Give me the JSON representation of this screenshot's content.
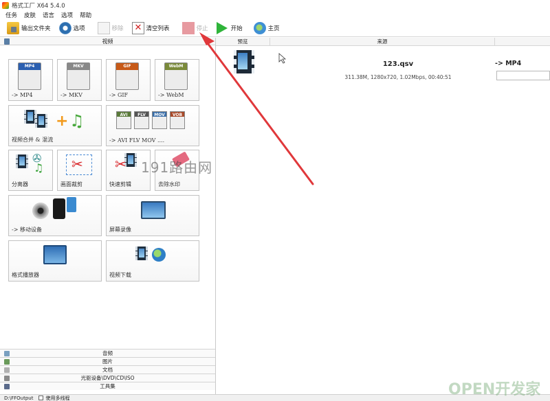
{
  "window": {
    "title": "格式工厂 X64 5.4.0"
  },
  "menu": [
    "任务",
    "皮肤",
    "语言",
    "选项",
    "帮助"
  ],
  "toolbar": {
    "output_folder": "输出文件夹",
    "options": "选项",
    "remove": "移除",
    "clear_list": "清空列表",
    "stop": "停止",
    "start": "开始",
    "home": "主页"
  },
  "left": {
    "section_video": "视频",
    "tiles": {
      "mp4": {
        "badge": "MP4",
        "label": "-> MP4"
      },
      "mkv": {
        "badge": "MKV",
        "label": "-> MKV"
      },
      "gif": {
        "badge": "GIF",
        "label": "-> GIF"
      },
      "webm": {
        "badge": "WebM",
        "label": "-> WebM"
      },
      "merge": {
        "label": "视频合并 & 混流"
      },
      "multi": {
        "label": "-> AVI FLV MOV ....",
        "badges": [
          "AVI",
          "FLV",
          "MOV",
          "VOB"
        ]
      },
      "splitter": {
        "label": "分离器"
      },
      "crop": {
        "label": "画面裁剪"
      },
      "quickcut": {
        "label": "快速剪辑"
      },
      "watermark": {
        "label": "去除水印"
      },
      "mobile": {
        "label": "-> 移动设备"
      },
      "screenrec": {
        "label": "屏幕录像"
      },
      "player": {
        "label": "格式播放器"
      },
      "download": {
        "label": "视频下载"
      }
    },
    "categories": [
      "音频",
      "图片",
      "文档",
      "光驱设备\\DVD\\CD\\ISO",
      "工具集"
    ]
  },
  "table": {
    "headers": {
      "preview": "预览",
      "source": "来源"
    },
    "rows": [
      {
        "name": "123.qsv",
        "info": "311.38M, 1280x720, 1.02Mbps, 00:40:51",
        "target": "-> MP4"
      }
    ]
  },
  "status": {
    "output_path": "D:\\FFOutput",
    "multithread": "使用多线程"
  },
  "watermarks": {
    "center": "191路由网",
    "corner": "OPEN开发家园"
  },
  "colors": {
    "arrow": "#e0383b",
    "start_green": "#2fb43a"
  }
}
